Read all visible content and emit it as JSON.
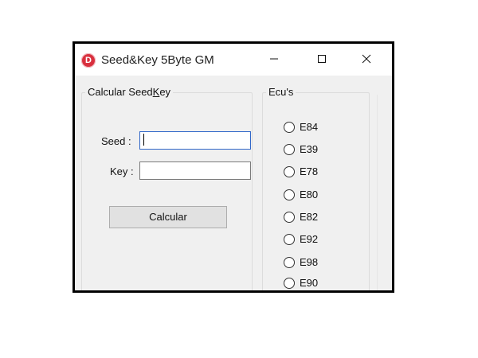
{
  "window": {
    "title": "Seed&Key 5Byte GM",
    "icon_letter": "D",
    "icon_color": "#d9303e",
    "controls": {
      "minimize": "—",
      "maximize": "☐",
      "close": "✕"
    }
  },
  "calc_group": {
    "legend_prefix": "Calcular Seed",
    "legend_underlined": "K",
    "legend_suffix": "ey",
    "seed_label": "Seed :",
    "seed_value": "",
    "key_label": "Key :",
    "key_value": "",
    "button_label": "Calcular"
  },
  "ecus_group": {
    "legend": "Ecu's",
    "options": [
      "E84",
      "E39",
      "E78",
      "E80",
      "E82",
      "E92",
      "E98",
      "E90"
    ]
  }
}
